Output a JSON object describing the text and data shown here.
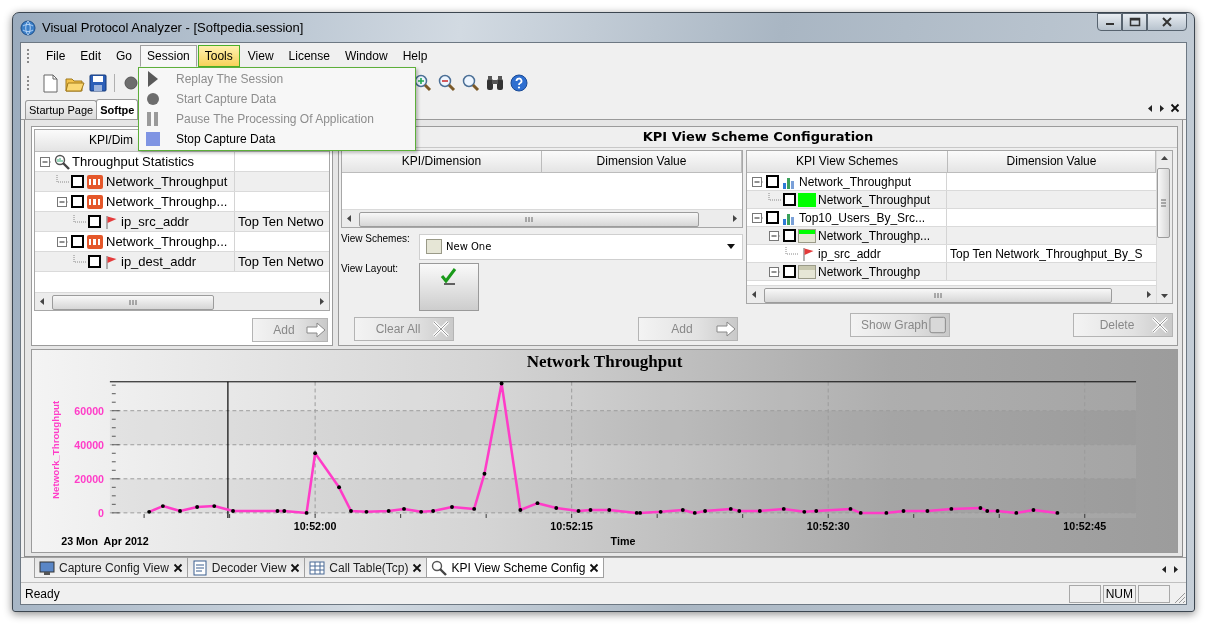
{
  "window": {
    "title": "Visual Protocol Analyzer - [Softpedia.session]"
  },
  "menu_bar": [
    {
      "label": "File",
      "open": false,
      "hovered": false
    },
    {
      "label": "Edit",
      "open": false,
      "hovered": false
    },
    {
      "label": "Go",
      "open": false,
      "hovered": false
    },
    {
      "label": "Session",
      "open": true,
      "hovered": false
    },
    {
      "label": "Tools",
      "open": false,
      "hovered": true
    },
    {
      "label": "View",
      "open": false,
      "hovered": false
    },
    {
      "label": "License",
      "open": false,
      "hovered": false
    },
    {
      "label": "Window",
      "open": false,
      "hovered": false
    },
    {
      "label": "Help",
      "open": false,
      "hovered": false
    }
  ],
  "session_menu": [
    {
      "label": "Replay The Session",
      "kind": "play",
      "disabled": true
    },
    {
      "label": "Start Capture Data",
      "kind": "record",
      "disabled": true
    },
    {
      "label": "Pause The Processing Of Application",
      "kind": "pause",
      "disabled": true
    },
    {
      "label": "Stop Capture Data",
      "kind": "stop",
      "disabled": false
    }
  ],
  "document_tabs": [
    {
      "label": "Startup Page",
      "selected": false
    },
    {
      "label": "Softpe",
      "selected": true
    }
  ],
  "kpi_tree": {
    "columns": [
      "KPI/Dim"
    ],
    "items": [
      {
        "label": "Throughput Statistics",
        "kind": "group",
        "expanded": true,
        "children": [
          {
            "label": "Network_Throughput",
            "kind": "kpi",
            "checked": false
          },
          {
            "label": "Network_Throughp...",
            "kind": "kpi",
            "checked": false,
            "expanded": true,
            "children": [
              {
                "label": "ip_src_addr",
                "kind": "dimension",
                "checked": false,
                "value": "Top Ten Netwo"
              }
            ]
          },
          {
            "label": "Network_Throughp...",
            "kind": "kpi",
            "checked": false,
            "expanded": true,
            "children": [
              {
                "label": "ip_dest_addr",
                "kind": "dimension",
                "checked": false,
                "value": "Top Ten Netwo"
              }
            ]
          }
        ]
      }
    ],
    "button": {
      "label": "Add",
      "disabled": true
    }
  },
  "config_panel": {
    "title": "KPI View Scheme Configuration",
    "grid_columns": [
      "KPI/Dimension",
      "Dimension Value"
    ],
    "view_schemes": {
      "label": "View Schemes:",
      "value": "New One"
    },
    "view_layout": {
      "label": "View Layout:"
    },
    "buttons": [
      {
        "label": "Clear All",
        "kind": "clear",
        "disabled": true
      },
      {
        "label": "Add",
        "kind": "add",
        "disabled": true
      }
    ]
  },
  "scheme_tree": {
    "columns": [
      "KPI View Schemes",
      "Dimension Value"
    ],
    "items": [
      {
        "label": "Network_Throughput",
        "kind": "scheme",
        "checked": false,
        "expanded": true,
        "children": [
          {
            "label": "Network_Throughput",
            "kind": "series",
            "checked": false,
            "color": "#00ff00",
            "banded": false
          }
        ]
      },
      {
        "label": "Top10_Users_By_Src...",
        "kind": "scheme",
        "checked": false,
        "expanded": true,
        "children": [
          {
            "label": "Network_Throughp...",
            "kind": "series",
            "checked": false,
            "color": "#00ff00",
            "banded": true,
            "expanded": true,
            "children": [
              {
                "label": "ip_src_addr",
                "kind": "dimension",
                "value": "Top Ten Network_Throughput_By_S"
              }
            ]
          },
          {
            "label": "Network_Throughp",
            "kind": "series",
            "checked": false,
            "color": "#c8c8b0",
            "banded": true,
            "expanded": true
          }
        ]
      }
    ],
    "buttons": [
      {
        "label": "Show Graph",
        "kind": "graph",
        "disabled": true
      },
      {
        "label": "Delete",
        "kind": "clear",
        "disabled": true
      }
    ]
  },
  "chart": {
    "date_label": "23 Mon  Apr 2012",
    "chart_data": {
      "type": "line",
      "title": "Network Throughput",
      "xlabel": "Time",
      "ylabel": "Network_Throughput",
      "x": [
        39110.3,
        39111.1,
        39112.1,
        39113.1,
        39114.1,
        39115.2,
        39117.8,
        39118.2,
        39119.5,
        39120,
        39121.4,
        39122.1,
        39123,
        39124.3,
        39125.2,
        39126.2,
        39126.9,
        39128,
        39129.3,
        39129.9,
        39130.9,
        39132,
        39133,
        39134.1,
        39135.4,
        39136.1,
        39137.2,
        39138.8,
        39139,
        39140.2,
        39141.5,
        39142.2,
        39142.8,
        39144.3,
        39144.8,
        39146,
        39147.4,
        39148.6,
        39149.3,
        39151.3,
        39151.9,
        39153.4,
        39154.4,
        39155.8,
        39157.2,
        39158.9,
        39159.3,
        39159.9,
        39161,
        39162,
        39163.4
      ],
      "series": [
        {
          "color": "#ff3cc8",
          "values": [
            600,
            4000,
            1100,
            3400,
            4000,
            1100,
            1100,
            1100,
            0,
            35000,
            15000,
            1100,
            600,
            1100,
            2300,
            600,
            1100,
            3400,
            2300,
            23000,
            76000,
            1700,
            5700,
            2900,
            1100,
            1700,
            1700,
            0,
            0,
            600,
            1700,
            0,
            1100,
            2300,
            1100,
            1100,
            2300,
            600,
            1100,
            2300,
            0,
            0,
            1100,
            1100,
            2300,
            2900,
            1100,
            1100,
            0,
            1700,
            0
          ]
        }
      ],
      "xlim": [
        39108,
        39168
      ],
      "ylim": [
        -3000,
        77000
      ],
      "xticks": [
        {
          "value": 39120,
          "label": "10:52:00"
        },
        {
          "value": 39135,
          "label": "10:52:15"
        },
        {
          "value": 39150,
          "label": "10:52:30"
        },
        {
          "value": 39165,
          "label": "10:52:45"
        }
      ],
      "yticks": [
        0,
        20000,
        40000,
        60000
      ],
      "grid": true,
      "ref_lines": [
        {
          "axis": "x",
          "value": 39114.9
        }
      ]
    }
  },
  "bottom_tabs": [
    {
      "label": "Capture Config View",
      "kind": "monitor",
      "selected": false
    },
    {
      "label": "Decoder View",
      "kind": "document",
      "selected": false
    },
    {
      "label": "Call Table(Tcp)",
      "kind": "table",
      "selected": false
    },
    {
      "label": "KPI View Scheme Config",
      "kind": "magnifier",
      "selected": true
    }
  ],
  "status_bar": {
    "text": "Ready",
    "indicators": [
      "NUM"
    ]
  }
}
